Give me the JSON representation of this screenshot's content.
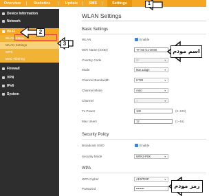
{
  "topnav": {
    "tabs": [
      "Overview",
      "Statistics",
      "Update",
      "SMS",
      "Settings"
    ],
    "active": "Settings"
  },
  "sidebar": {
    "device_information": "Device Information",
    "network": "Network",
    "wifi": "Wi-Fi",
    "wifi_items": [
      "WLAN Status",
      "WLAN Settings",
      "WPS",
      "MAC Filtering"
    ],
    "firewall": "Firewall",
    "vpn": "VPN",
    "ipv6": "IPv6",
    "system": "System"
  },
  "page": {
    "title": "WLAN Settings",
    "basic_settings": "Basic Settings",
    "wlan_label": "WLAN",
    "wlan_check": "Enable",
    "ssid_label": "WiFi Name (SSID)",
    "ssid_value": "TF-i60 G1-D500",
    "country_label": "Country Code",
    "country_value": "ID",
    "mode_label": "Mode",
    "mode_value": "802.11bgn",
    "bandwidth_label": "Channel Bandwidth",
    "bandwidth_value": "HT20",
    "chmode_label": "Channel Mode",
    "chmode_value": "Auto",
    "channel_label": "Channel",
    "channel_value": "1",
    "txpower_label": "Tx Power",
    "txpower_value": "100",
    "txpower_hint": "(0~100)",
    "maxusers_label": "Max Users",
    "maxusers_value": "12",
    "maxusers_hint": "(1~16)",
    "security_policy": "Security Policy",
    "broadcast_label": "Broadcast SSID",
    "broadcast_check": "Enable",
    "secmode_label": "Security Mode",
    "secmode_value": "WPA2-PSK",
    "wpa": "WPA",
    "cipher_label": "WPA Cipher",
    "cipher_value": "AES/TKIP",
    "password_label": "Password",
    "password_value": "••••••••"
  },
  "annotations": {
    "one": "1",
    "two": "2",
    "three": "3",
    "ssid_callout": "اسم مودم",
    "password_callout": "رمز مودم"
  },
  "colors": {
    "orange": "#f5a623",
    "sidebar_dark": "#2e2e2e",
    "checkbox_blue": "#3b82d6",
    "highlight_red": "#e53935"
  }
}
